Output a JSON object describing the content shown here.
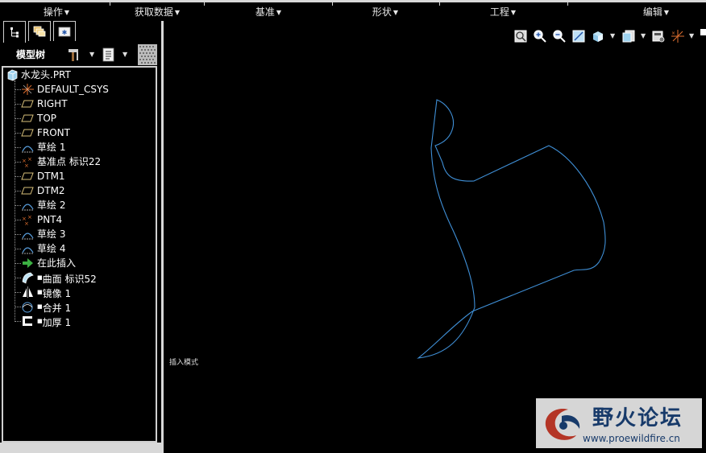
{
  "menu": {
    "items": [
      "操作",
      "获取数据",
      "基准",
      "形状",
      "工程",
      "编辑"
    ]
  },
  "left_panel": {
    "tabs": [
      "model-tree-tab",
      "layers-tab",
      "favorites-tab"
    ],
    "toolbar_title": "模型树",
    "tree": {
      "root": "水龙头.PRT",
      "items": [
        {
          "label": "DEFAULT_CSYS",
          "icon": "csys-icon"
        },
        {
          "label": "RIGHT",
          "icon": "datum-plane-icon"
        },
        {
          "label": "TOP",
          "icon": "datum-plane-icon"
        },
        {
          "label": "FRONT",
          "icon": "datum-plane-icon"
        },
        {
          "label": "草绘 1",
          "icon": "sketch-icon"
        },
        {
          "label": "基准点 标识22",
          "icon": "datum-point-icon"
        },
        {
          "label": "DTM1",
          "icon": "datum-plane-icon"
        },
        {
          "label": "DTM2",
          "icon": "datum-plane-icon"
        },
        {
          "label": "草绘 2",
          "icon": "sketch-icon"
        },
        {
          "label": "PNT4",
          "icon": "datum-point-icon"
        },
        {
          "label": "草绘 3",
          "icon": "sketch-icon"
        },
        {
          "label": "草绘 4",
          "icon": "sketch-icon"
        },
        {
          "label": "在此插入",
          "icon": "insert-here-arrow-icon"
        },
        {
          "label": "曲面 标识52",
          "icon": "surface-icon"
        },
        {
          "label": "镜像 1",
          "icon": "mirror-icon"
        },
        {
          "label": "合并 1",
          "icon": "merge-icon"
        },
        {
          "label": "加厚 1",
          "icon": "thicken-icon"
        }
      ]
    }
  },
  "viewport": {
    "status_text": "插入模式",
    "curve_color": "#3f8fd6"
  },
  "watermark": {
    "title": "野火论坛",
    "url": "www.proewildfire.cn"
  },
  "colors": {
    "background": "#000000",
    "border": "#d0d0d0",
    "watermark_text": "#1a3f73"
  }
}
